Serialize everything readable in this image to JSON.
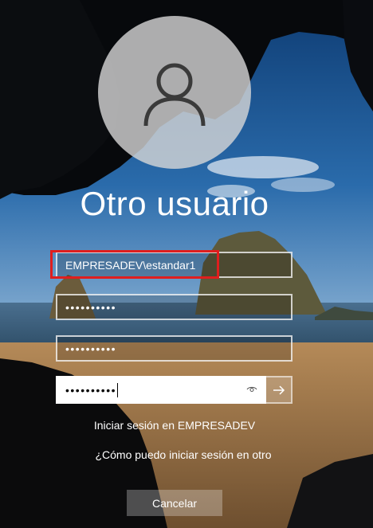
{
  "user": {
    "display_name": "Otro usuario",
    "avatar_icon": "user-silhouette-icon"
  },
  "form": {
    "username_value": "EMPRESADEV\\estandar1",
    "password_value": "••••••••••",
    "new_password_value": "••••••••••",
    "confirm_password_value": "••••••••••",
    "reveal_icon": "eye-icon",
    "submit_icon": "arrow-right-icon"
  },
  "domain_text": "Iniciar sesión en EMPRESADEV",
  "help_link": "¿Cómo puedo iniciar sesión en otro",
  "cancel_label": "Cancelar",
  "colors": {
    "highlight_border": "#e01e1e",
    "active_field_bg": "#ffffff"
  }
}
